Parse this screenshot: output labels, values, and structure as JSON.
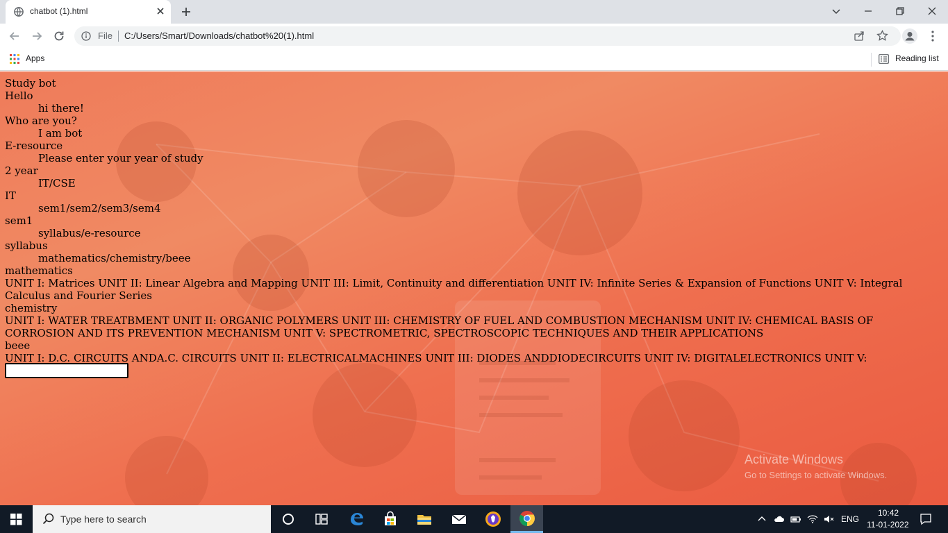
{
  "browser": {
    "tab_title": "chatbot (1).html",
    "omnibox": {
      "scheme_label": "File",
      "url": "C:/Users/Smart/Downloads/chatbot%20(1).html"
    },
    "bookmarks": {
      "apps_label": "Apps",
      "reading_list_label": "Reading list"
    }
  },
  "page": {
    "messages": [
      {
        "role": "user",
        "text": "Study bot"
      },
      {
        "role": "user",
        "text": "Hello"
      },
      {
        "role": "bot",
        "text": "hi there!"
      },
      {
        "role": "user",
        "text": "Who are you?"
      },
      {
        "role": "bot",
        "text": "I am bot"
      },
      {
        "role": "user",
        "text": "E-resource"
      },
      {
        "role": "bot",
        "text": "Please enter your year of study"
      },
      {
        "role": "user",
        "text": "2 year"
      },
      {
        "role": "bot",
        "text": "IT/CSE"
      },
      {
        "role": "user",
        "text": "IT"
      },
      {
        "role": "bot",
        "text": "sem1/sem2/sem3/sem4"
      },
      {
        "role": "user",
        "text": "sem1"
      },
      {
        "role": "bot",
        "text": "syllabus/e-resource"
      },
      {
        "role": "user",
        "text": "syllabus"
      },
      {
        "role": "bot",
        "text": "mathematics/chemistry/beee"
      },
      {
        "role": "user",
        "text": "mathematics"
      },
      {
        "role": "user",
        "text": "UNIT I: Matrices UNIT II: Linear Algebra and Mapping UNIT III: Limit, Continuity and differentiation UNIT IV: Infinite Series & Expansion of Functions UNIT V: Integral Calculus and Fourier Series"
      },
      {
        "role": "user",
        "text": "chemistry"
      },
      {
        "role": "user",
        "text": "UNIT I: WATER TREATBMENT UNIT II: ORGANIC POLYMERS UNIT III: CHEMISTRY OF FUEL AND COMBUSTION MECHANISM UNIT IV: CHEMICAL BASIS OF CORROSION AND ITS PREVENTION MECHANISM UNIT V: SPECTROMETRIC, SPECTROSCOPIC TECHNIQUES AND THEIR APPLICATIONS"
      },
      {
        "role": "user",
        "text": "beee"
      },
      {
        "role": "user",
        "text": "UNIT I: D.C. CIRCUITS ANDA.C. CIRCUITS UNIT II: ELECTRICALMACHINES UNIT III: DIODES ANDDIODECIRCUITS UNIT IV: DIGITALELECTRONICS UNIT V: TRANSDUCERS"
      }
    ],
    "input": {
      "value": ""
    },
    "watermark": {
      "line1": "Activate Windows",
      "line2": "Go to Settings to activate Windows."
    }
  },
  "taskbar": {
    "search_placeholder": "Type here to search",
    "language": "ENG",
    "time": "10:42",
    "date": "11-01-2022",
    "pinned_apps": [
      "cortana-icon",
      "task-view-icon",
      "edge-icon",
      "store-icon",
      "file-explorer-icon",
      "mail-icon",
      "brave-icon",
      "chrome-icon"
    ]
  }
}
